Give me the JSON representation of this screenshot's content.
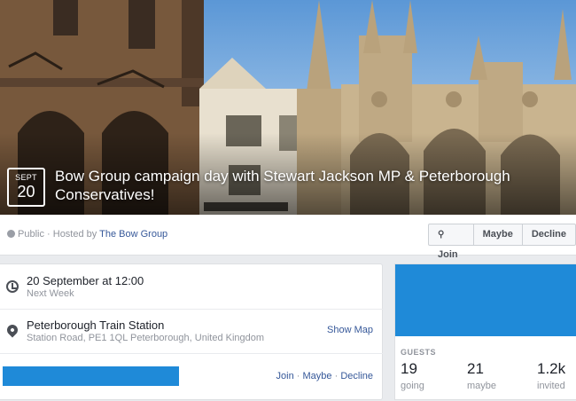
{
  "event": {
    "date_month": "SEPT",
    "date_day": "20",
    "title": "Bow Group campaign day with Stewart Jackson MP & Peterborough Conservatives!"
  },
  "host_bar": {
    "privacy": "Public",
    "hosted_by_prefix": " · Hosted by ",
    "host_name": "The Bow Group",
    "join_label": "Join",
    "maybe_label": "Maybe",
    "decline_label": "Decline"
  },
  "details": {
    "time_main": "20 September at 12:00",
    "time_sub": "Next Week",
    "place_main": "Peterborough Train Station",
    "place_sub": "Station Road, PE1 1QL Peterborough, United Kingdom",
    "show_map_label": "Show Map",
    "join_link": "Join",
    "maybe_link": "Maybe",
    "decline_link": "Decline",
    "separator": " · "
  },
  "guests": {
    "title": "GUESTS",
    "going_count": "19",
    "going_label": "going",
    "maybe_count": "21",
    "maybe_label": "maybe",
    "invited_count": "1.2k",
    "invited_label": "invited"
  },
  "colors": {
    "link": "#365899",
    "accent_blue": "#1f8ad8",
    "muted_text": "#90949c"
  },
  "icons": [
    "globe-icon",
    "join-icon",
    "clock-icon",
    "location-pin-icon"
  ]
}
